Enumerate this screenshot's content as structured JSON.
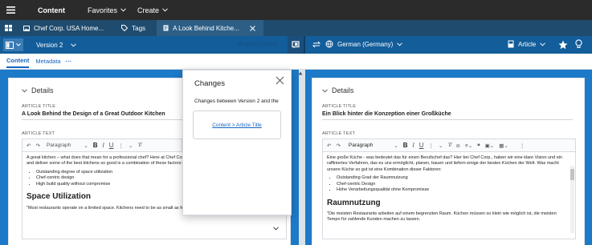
{
  "topbar": {
    "menu_icon": "hamburger-icon",
    "title": "Content",
    "favorites": "Favorites",
    "create": "Create"
  },
  "tabs": [
    {
      "label": "Chef Corp. USA Home...",
      "icon": "image-icon"
    },
    {
      "label": "Tags",
      "icon": "tag-icon"
    },
    {
      "label": "A Look Behind Kitche...",
      "icon": "document-icon"
    }
  ],
  "tab_close_icon": "close-icon",
  "left_toolbar": {
    "version": "Version 2",
    "source_language": "English (United..."
  },
  "right_toolbar": {
    "language": "German (Germany)",
    "doc_type": "Article"
  },
  "subnav": {
    "content": "Content",
    "metadata": "Metadata",
    "more": "···"
  },
  "left_doc": {
    "details": "Details",
    "title_label": "ARTICLE TITLE",
    "title": "A Look Behind the Design of a Great Outdoor Kitchen",
    "text_label": "ARTICLE TEXT",
    "paragraph_select": "Paragraph",
    "intro": "A great kitchen – what does that mean for a professional chef? Here at Chef Corp. refined process that enables us to design, build, and deliver some of the best kitchens so good is a combination of these factors:",
    "bullets": [
      "Outstanding degree of space utilization",
      "Chef-centric design",
      "High build quality without compromise"
    ],
    "heading": "Space Utilization",
    "para2": "\"Most restaurants operate on a limited space. Kitchens need to be as small as feasible to make the most room for"
  },
  "right_doc": {
    "details": "Details",
    "title_label": "ARTICLE TITLE",
    "title": "Ein Blick hinter die Konzeption einer Großküche",
    "text_label": "ARTICLE TEXT",
    "paragraph_select": "Paragraph",
    "intro": "Eine große Küche - was bedeutet das für einen Berufschef das? Hier bei Chef Corp., haben wir eine klare Vision und ein raffiniertes Verfahren, das es uns ermöglicht, planen, bauen und liefern einige der besten Küchen der Welt. Was macht unsere Küche so gut ist eine Kombination dieser Faktoren:",
    "bullets": [
      "Outstanding Grad der Raumnutzung",
      "Chef-centric Design",
      "Hohe Verarbeitungsqualität ohne Kompromisse"
    ],
    "heading": "Raumnutzung",
    "para2": "\"Die meisten Restaurants arbeiten auf einem begrenzten Raum. Küchen müssen so klein wie möglich ist, die meisten Tempo für zahlende Kunden machen zu lassen."
  },
  "popup": {
    "title": "Changes",
    "description": "Changes between Version 2 and the",
    "link": "Content > Article Title"
  },
  "colors": {
    "topbar": "#2b2b2b",
    "tabbar": "#1f4b6e",
    "langbar": "#125d9a",
    "panel": "#1d7ac8",
    "accent_link": "#1565c0"
  }
}
